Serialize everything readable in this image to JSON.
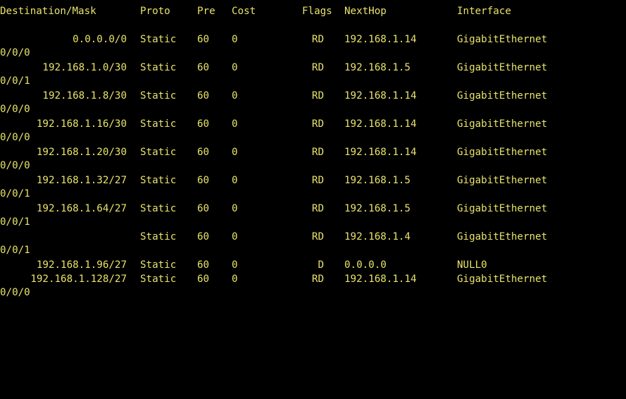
{
  "terminal": {
    "colors": {
      "background": "#000000",
      "text": "#e9e36a"
    },
    "header": {
      "destination": "Destination/Mask",
      "proto": "Proto",
      "pre": "Pre",
      "cost": "Cost",
      "flags": "Flags",
      "nexthop": "NextHop",
      "interface": "Interface"
    },
    "routes": [
      {
        "destination": "0.0.0.0/0",
        "proto": "Static",
        "pre": "60",
        "cost": "0",
        "flags": "RD",
        "nexthop": "192.168.1.14",
        "interface": "GigabitEthernet",
        "interface_wrap": "0/0/0"
      },
      {
        "destination": "192.168.1.0/30",
        "proto": "Static",
        "pre": "60",
        "cost": "0",
        "flags": "RD",
        "nexthop": "192.168.1.5",
        "interface": "GigabitEthernet",
        "interface_wrap": "0/0/1"
      },
      {
        "destination": "192.168.1.8/30",
        "proto": "Static",
        "pre": "60",
        "cost": "0",
        "flags": "RD",
        "nexthop": "192.168.1.14",
        "interface": "GigabitEthernet",
        "interface_wrap": "0/0/0"
      },
      {
        "destination": "192.168.1.16/30",
        "proto": "Static",
        "pre": "60",
        "cost": "0",
        "flags": "RD",
        "nexthop": "192.168.1.14",
        "interface": "GigabitEthernet",
        "interface_wrap": "0/0/0"
      },
      {
        "destination": "192.168.1.20/30",
        "proto": "Static",
        "pre": "60",
        "cost": "0",
        "flags": "RD",
        "nexthop": "192.168.1.14",
        "interface": "GigabitEthernet",
        "interface_wrap": "0/0/0"
      },
      {
        "destination": "192.168.1.32/27",
        "proto": "Static",
        "pre": "60",
        "cost": "0",
        "flags": "RD",
        "nexthop": "192.168.1.5",
        "interface": "GigabitEthernet",
        "interface_wrap": "0/0/1"
      },
      {
        "destination": "192.168.1.64/27",
        "proto": "Static",
        "pre": "60",
        "cost": "0",
        "flags": "RD",
        "nexthop": "192.168.1.5",
        "interface": "GigabitEthernet",
        "interface_wrap": "0/0/1"
      },
      {
        "destination": "",
        "proto": "Static",
        "pre": "60",
        "cost": "0",
        "flags": "RD",
        "nexthop": "192.168.1.4",
        "interface": "GigabitEthernet",
        "interface_wrap": "0/0/1"
      },
      {
        "destination": "192.168.1.96/27",
        "proto": "Static",
        "pre": "60",
        "cost": "0",
        "flags": "D",
        "nexthop": "0.0.0.0",
        "interface": "NULL0",
        "interface_wrap": ""
      },
      {
        "destination": "192.168.1.128/27",
        "proto": "Static",
        "pre": "60",
        "cost": "0",
        "flags": "RD",
        "nexthop": "192.168.1.14",
        "interface": "GigabitEthernet",
        "interface_wrap": "0/0/0"
      }
    ]
  }
}
